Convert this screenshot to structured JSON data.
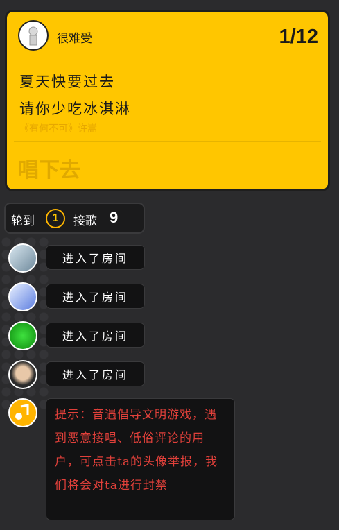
{
  "card": {
    "username": "很难受",
    "page_indicator": "1/12",
    "lyric_line_1": "夏天快要过去",
    "lyric_line_2": "请你少吃冰淇淋",
    "song_source": "《有何不可》许嵩",
    "sing_button": "唱下去"
  },
  "turn_bar": {
    "label_turn": "轮到",
    "turn_number": "1",
    "label_next": "接歌",
    "next_number": "9"
  },
  "messages": [
    {
      "text": "进入了房间"
    },
    {
      "text": "进入了房间"
    },
    {
      "text": "进入了房间"
    },
    {
      "text": "进入了房间"
    }
  ],
  "notice": {
    "text": "提示：音遇倡导文明游戏，遇到恶意接唱、低俗评论的用户，可点击ta的头像举报，我们将会对ta进行封禁"
  },
  "colors": {
    "background": "#2b2b2d",
    "card": "#ffc600",
    "notice_text": "#e0403a",
    "accent_ring": "#ffb600"
  }
}
